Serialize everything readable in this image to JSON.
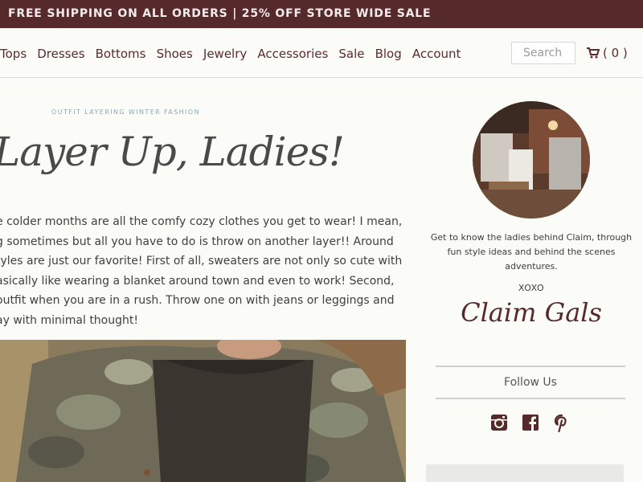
{
  "banner": {
    "text": "FREE SHIPPING ON ALL ORDERS | 25% OFF STORE WIDE SALE"
  },
  "nav": {
    "items": [
      "Tops",
      "Dresses",
      "Bottoms",
      "Shoes",
      "Jewelry",
      "Accessories",
      "Sale",
      "Blog",
      "Account"
    ],
    "search_placeholder": "Search",
    "cart_label": "( 0 )"
  },
  "post": {
    "tag": "OUTFIT LAYERING WINTER FASHION",
    "title": "Layer Up, Ladies!",
    "body_lines": [
      "e colder months are all the comfy cozy clothes you get to wear! I mean,",
      "g sometimes but all you have to do is throw on another layer!! Around",
      "tyles are just our favorite! First of all, sweaters are not only so cute with",
      "asically like wearing a blanket around town and even to work! Second,",
      "outfit when you are in a rush. Throw one on with jeans or leggings and",
      "ay with minimal thought!"
    ]
  },
  "sidebar": {
    "about": "Get to know the ladies behind Claim, through fun style ideas and behind the scenes adventures.",
    "xoxo": "XOXO",
    "signature": "Claim Gals",
    "follow_heading": "Follow Us",
    "social_icons": [
      "instagram-icon",
      "facebook-icon",
      "pinterest-icon"
    ]
  },
  "colors": {
    "brand": "#56292b",
    "background": "#fbfbf7",
    "tag": "#8aa9b6"
  }
}
